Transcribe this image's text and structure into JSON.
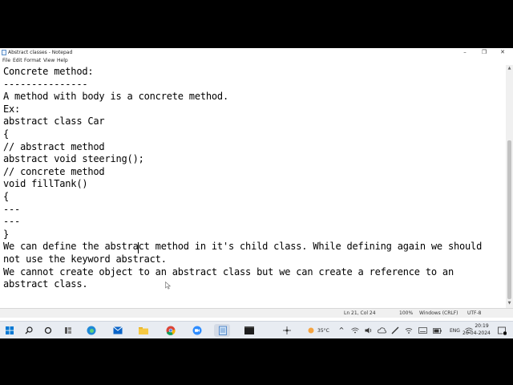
{
  "window": {
    "title": "Abstract classes - Notepad",
    "minimize": "–",
    "maximize": "❐",
    "close": "✕"
  },
  "menu": [
    "File",
    "Edit",
    "Format",
    "View",
    "Help"
  ],
  "editor": {
    "lines": [
      "Concrete method:",
      "---------------",
      "A method with body is a concrete method.",
      "Ex:",
      "abstract class Car",
      "{",
      "// abstract method",
      "abstract void steering();",
      "// concrete method",
      "void fillTank()",
      "{",
      "---",
      "---",
      "}",
      "We can define the abstract method in it's child class. While defining again we should",
      "not use the keyword abstract.",
      "We cannot create object to an abstract class but we can create a reference to an",
      "abstract class."
    ]
  },
  "status": {
    "position": "Ln 21, Col 24",
    "zoom": "100%",
    "line_ending": "Windows (CRLF)",
    "encoding": "UTF-8"
  },
  "taskbar": {
    "icons": [
      "windows-start-icon",
      "search-icon",
      "task-view-icon",
      "widgets-icon",
      "edge-icon",
      "mail-icon",
      "file-explorer-icon",
      "chrome-icon",
      "zoom-icon",
      "notepad-icon",
      "terminal-icon"
    ],
    "weather": "35°C",
    "language": "ENG",
    "time": "20:19",
    "date": "26-04-2024",
    "notification_count": "1"
  }
}
